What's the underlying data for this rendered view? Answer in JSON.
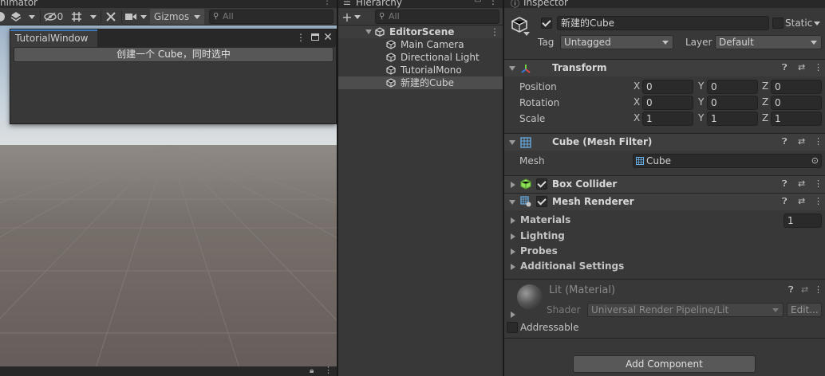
{
  "scene": {
    "tab_title": "nimator",
    "toolbar": {
      "hidden_count": "0",
      "gizmos_label": "Gizmos",
      "search_placeholder": "All"
    }
  },
  "tutorial_window": {
    "tab_label": "TutorialWindow",
    "button_label": "创建一个 Cube，同时选中"
  },
  "hierarchy": {
    "tab_title": "Hierarchy",
    "search_placeholder": "All",
    "scene_name": "EditorScene",
    "items": [
      "Main Camera",
      "Directional Light",
      "TutorialMono",
      "新建的Cube"
    ],
    "selected_index": 3
  },
  "inspector": {
    "tab_title": "Inspector",
    "object_name": "新建的Cube",
    "active": true,
    "static_label": "Static",
    "tag_label": "Tag",
    "tag_value": "Untagged",
    "layer_label": "Layer",
    "layer_value": "Default",
    "transform": {
      "title": "Transform",
      "rows": [
        {
          "label": "Position",
          "x": "0",
          "y": "0",
          "z": "0"
        },
        {
          "label": "Rotation",
          "x": "0",
          "y": "0",
          "z": "0"
        },
        {
          "label": "Scale",
          "x": "1",
          "y": "1",
          "z": "1"
        }
      ],
      "axis_x": "X",
      "axis_y": "Y",
      "axis_z": "Z"
    },
    "mesh_filter": {
      "title": "Cube (Mesh Filter)",
      "mesh_label": "Mesh",
      "mesh_value": "Cube"
    },
    "box_collider": {
      "title": "Box Collider",
      "enabled": true
    },
    "mesh_renderer": {
      "title": "Mesh Renderer",
      "enabled": true,
      "materials_label": "Materials",
      "materials_count": "1",
      "lighting_label": "Lighting",
      "probes_label": "Probes",
      "additional_label": "Additional Settings"
    },
    "material": {
      "name": "Lit (Material)",
      "shader_label": "Shader",
      "shader_value": "Universal Render Pipeline/Lit",
      "edit_label": "Edit..."
    },
    "addressable_label": "Addressable",
    "add_component_label": "Add Component"
  },
  "colors": {
    "accent": "#3a79bb",
    "panel_bg": "#383838",
    "selection_bg": "#4d4d4d"
  }
}
